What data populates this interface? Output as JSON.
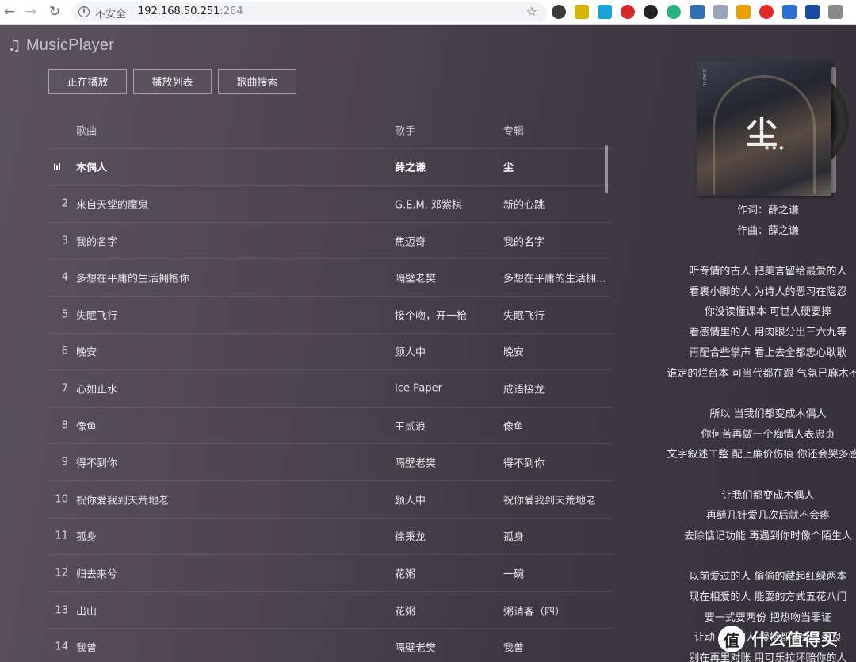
{
  "browser": {
    "insecure_label": "不安全",
    "url_host": "192.168.50.251",
    "url_port": ":264"
  },
  "app": {
    "title": "MusicPlayer"
  },
  "tabs": [
    "正在播放",
    "播放列表",
    "歌曲搜索"
  ],
  "table": {
    "headers": {
      "song": "歌曲",
      "artist": "歌手",
      "album": "专辑"
    },
    "rows": [
      {
        "num": "",
        "song": "木偶人",
        "artist": "薛之谦",
        "album": "尘",
        "playing": true
      },
      {
        "num": "2",
        "song": "来自天堂的魔鬼",
        "artist": "G.E.M. 邓紫棋",
        "album": "新的心跳"
      },
      {
        "num": "3",
        "song": "我的名字",
        "artist": "焦迈奇",
        "album": "我的名字"
      },
      {
        "num": "4",
        "song": "多想在平庸的生活拥抱你",
        "artist": "隔壁老樊",
        "album": "多想在平庸的生活拥..."
      },
      {
        "num": "5",
        "song": "失眠飞行",
        "artist": "接个吻，开一枪",
        "album": "失眠飞行"
      },
      {
        "num": "6",
        "song": "晚安",
        "artist": "颜人中",
        "album": "晚安"
      },
      {
        "num": "7",
        "song": "心如止水",
        "artist": "Ice Paper",
        "album": "成语接龙"
      },
      {
        "num": "8",
        "song": "像鱼",
        "artist": "王贰浪",
        "album": "像鱼"
      },
      {
        "num": "9",
        "song": "得不到你",
        "artist": "隔壁老樊",
        "album": "得不到你"
      },
      {
        "num": "10",
        "song": "祝你爱我到天荒地老",
        "artist": "颜人中",
        "album": "祝你爱我到天荒地老"
      },
      {
        "num": "11",
        "song": "孤身",
        "artist": "徐秉龙",
        "album": "孤身"
      },
      {
        "num": "12",
        "song": "归去来兮",
        "artist": "花粥",
        "album": "一碗"
      },
      {
        "num": "13",
        "song": "出山",
        "artist": "花粥",
        "album": "粥请客（四）"
      },
      {
        "num": "14",
        "song": "我曾",
        "artist": "隔壁老樊",
        "album": "我曾"
      }
    ]
  },
  "album_cover": {
    "glyph": "尘"
  },
  "lyrics": [
    "作词：薛之谦",
    "作曲：薛之谦",
    "",
    "听专情的古人 把美言留给最爱的人",
    "看裹小脚的人 为诗人的恶习在隐忍",
    "你没读懂课本 可世人硬要捧",
    "看感情里的人 用肉眼分出三六九等",
    "再配合些掌声 看上去全都忠心耿耿",
    "谁定的烂台本 可当代都在跟 气氛已麻木不仁",
    "",
    "所以 当我们都变成木偶人",
    "你何苦再做一个痴情人表忠贞",
    "文字叙述工整 配上廉价伤痕 你还会哭多感人",
    "",
    "让我们都变成木偶人",
    "再缝几针爱几次后就不会疼",
    "去除惦记功能 再遇到你时像个陌生人",
    "",
    "以前爱过的人 偷偷的藏起红绿两本",
    "现在相爱的人 能耍的方式五花八门",
    "要一式要两份 把热吻当罪证",
    "让动了情的人 慢慢都学会了善良",
    "别在再里对账 用可乐拉环赔你的人"
  ],
  "watermark": {
    "logo_char": "值",
    "text": "什么值得买"
  }
}
